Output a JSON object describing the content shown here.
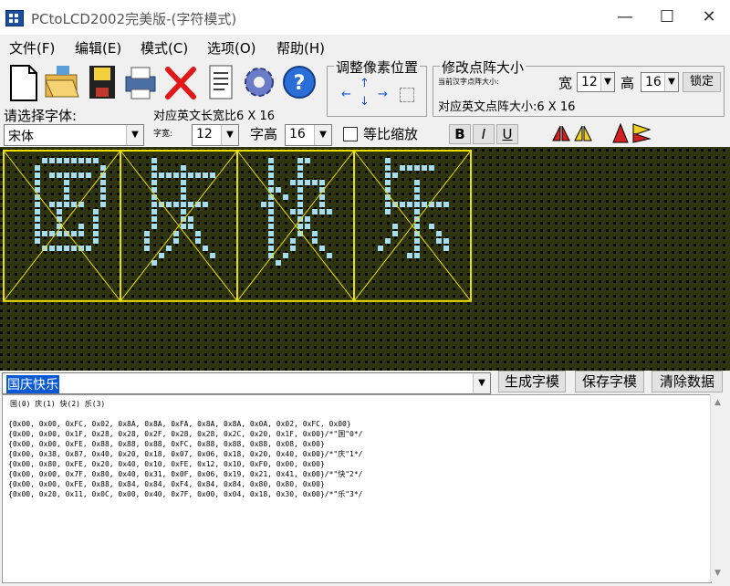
{
  "window": {
    "title": "PCtoLCD2002完美版-(字符模式)",
    "controls": [
      "—",
      "☐",
      "✕"
    ]
  },
  "menu": [
    "文件(F)",
    "编辑(E)",
    "模式(C)",
    "选项(O)",
    "帮助(H)"
  ],
  "toolbar": {
    "icons": [
      "new-file-icon",
      "open-folder-icon",
      "save-icon",
      "print-icon",
      "delete-icon",
      "notes-icon",
      "settings-gear-icon",
      "help-icon"
    ]
  },
  "pixel_adjust": {
    "label": "调整像素位置",
    "arrows": [
      "↑",
      "↓",
      "←",
      "→"
    ]
  },
  "dot_size": {
    "label": "修改点阵大小",
    "cn_label": "当前汉字点阵大小:",
    "width_label": "宽",
    "width_value": "12",
    "height_label": "高",
    "height_value": "16",
    "lock_label": "锁定",
    "en_label": "对应英文点阵大小:6 X 16"
  },
  "font_bar": {
    "select_label": "请选择字体:",
    "font_value": "宋体",
    "en_ratio_label": "对应英文长宽比6 X 16",
    "width_label": "字宽:",
    "width_value": "12",
    "height_label": "字高",
    "height_value": "16",
    "proportional_label": "等比缩放",
    "bold_label": "B",
    "italic_label": "I",
    "underline_label": "U"
  },
  "colors": {
    "pixel_on": "#a8dcf0",
    "pixel_off": "#2e3310",
    "grid_bg": "#000000",
    "guide": "#f0e000"
  },
  "input": {
    "text": "国庆快乐",
    "generate_label": "生成字模",
    "save_label": "保存字模",
    "clear_label": "清除数据"
  },
  "output": {
    "header": "国(0) 庆(1) 快(2) 乐(3)",
    "lines": [
      "{0x00, 0x00, 0xFC, 0x02, 0x8A, 0x8A, 0xFA, 0x8A, 0x8A, 0x0A, 0x02, 0xFC, 0x00}",
      "{0x00, 0x00, 0x1F, 0x28, 0x28, 0x2F, 0x28, 0x28, 0x2C, 0x20, 0x1F, 0x00}/*\"国\"0*/",
      "{0x00, 0x00, 0xFE, 0x88, 0x88, 0x88, 0xFC, 0x88, 0x88, 0x88, 0x08, 0x00}",
      "{0x00, 0x38, 0x87, 0x40, 0x20, 0x18, 0x07, 0x06, 0x18, 0x20, 0x40, 0x00}/*\"庆\"1*/",
      "{0x00, 0x80, 0xFE, 0x20, 0x40, 0x10, 0xFE, 0x12, 0x10, 0xF0, 0x00, 0x00}",
      "{0x00, 0x00, 0x7F, 0x80, 0x40, 0x31, 0x0F, 0x06, 0x19, 0x21, 0x41, 0x00}/*\"快\"2*/",
      "{0x00, 0x00, 0xFE, 0x88, 0x84, 0x84, 0xF4, 0x84, 0x84, 0x80, 0x80, 0x00}",
      "{0x00, 0x20, 0x11, 0x0C, 0x00, 0x40, 0x7F, 0x00, 0x04, 0x18, 0x30, 0x00}/*\"乐\"3*/"
    ]
  }
}
